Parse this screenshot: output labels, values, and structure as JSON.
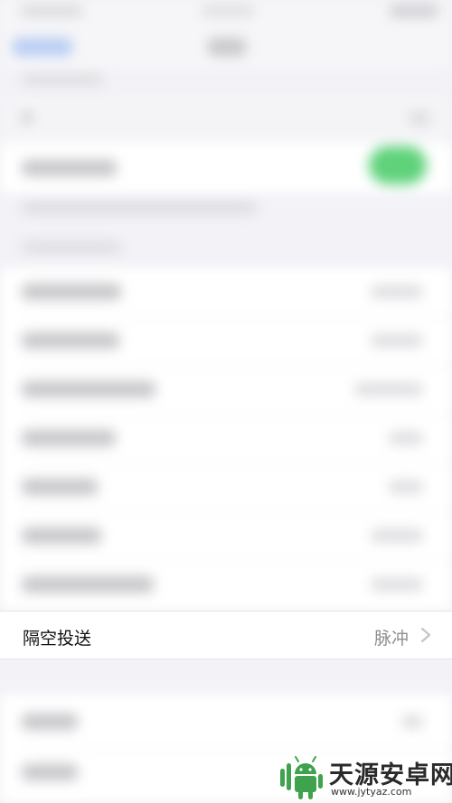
{
  "airdrop_row": {
    "label": "隔空投送",
    "value": "脉冲",
    "chevron_icon": "chevron-right-icon"
  },
  "watermark": {
    "brand": "天源安卓网",
    "url": "www.jytyaz.com",
    "logo_icon": "android-robot-logo"
  },
  "colors": {
    "toggle_on": "#5fd27a",
    "link_blue": "#b8cdf3",
    "value_gray": "#8e8e93"
  }
}
